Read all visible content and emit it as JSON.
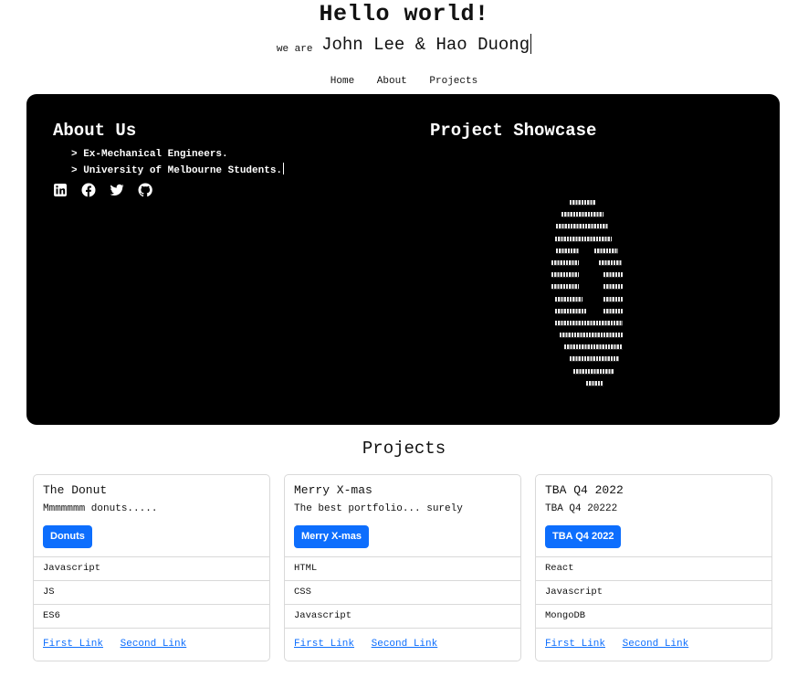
{
  "hero": {
    "title": "Hello world!",
    "prefix": "we are",
    "names": "John Lee & Hao Duong"
  },
  "nav": {
    "items": [
      "Home",
      "About",
      "Projects"
    ]
  },
  "about": {
    "title": "About Us",
    "lines": [
      "> Ex-Mechanical Engineers.",
      "> University of Melbourne Students."
    ],
    "socials": [
      "linkedin-icon",
      "facebook-icon",
      "twitter-icon",
      "github-icon"
    ]
  },
  "showcase": {
    "title": "Project Showcase"
  },
  "projects": {
    "title": "Projects",
    "cards": [
      {
        "title": "The Donut",
        "text": "Mmmmmmm donuts.....",
        "button": "Donuts",
        "items": [
          "Javascript",
          "JS",
          "ES6"
        ],
        "links": [
          "First Link",
          "Second Link"
        ]
      },
      {
        "title": "Merry X-mas",
        "text": "The best portfolio... surely",
        "button": "Merry X-mas",
        "items": [
          "HTML",
          "CSS",
          "Javascript"
        ],
        "links": [
          "First Link",
          "Second Link"
        ]
      },
      {
        "title": "TBA Q4 2022",
        "text": "TBA Q4 20222",
        "button": "TBA Q4 2022",
        "items": [
          "React",
          "Javascript",
          "MongoDB"
        ],
        "links": [
          "First Link",
          "Second Link"
        ]
      }
    ]
  },
  "colors": {
    "panel": "#000000",
    "accent": "#0d6efd"
  }
}
